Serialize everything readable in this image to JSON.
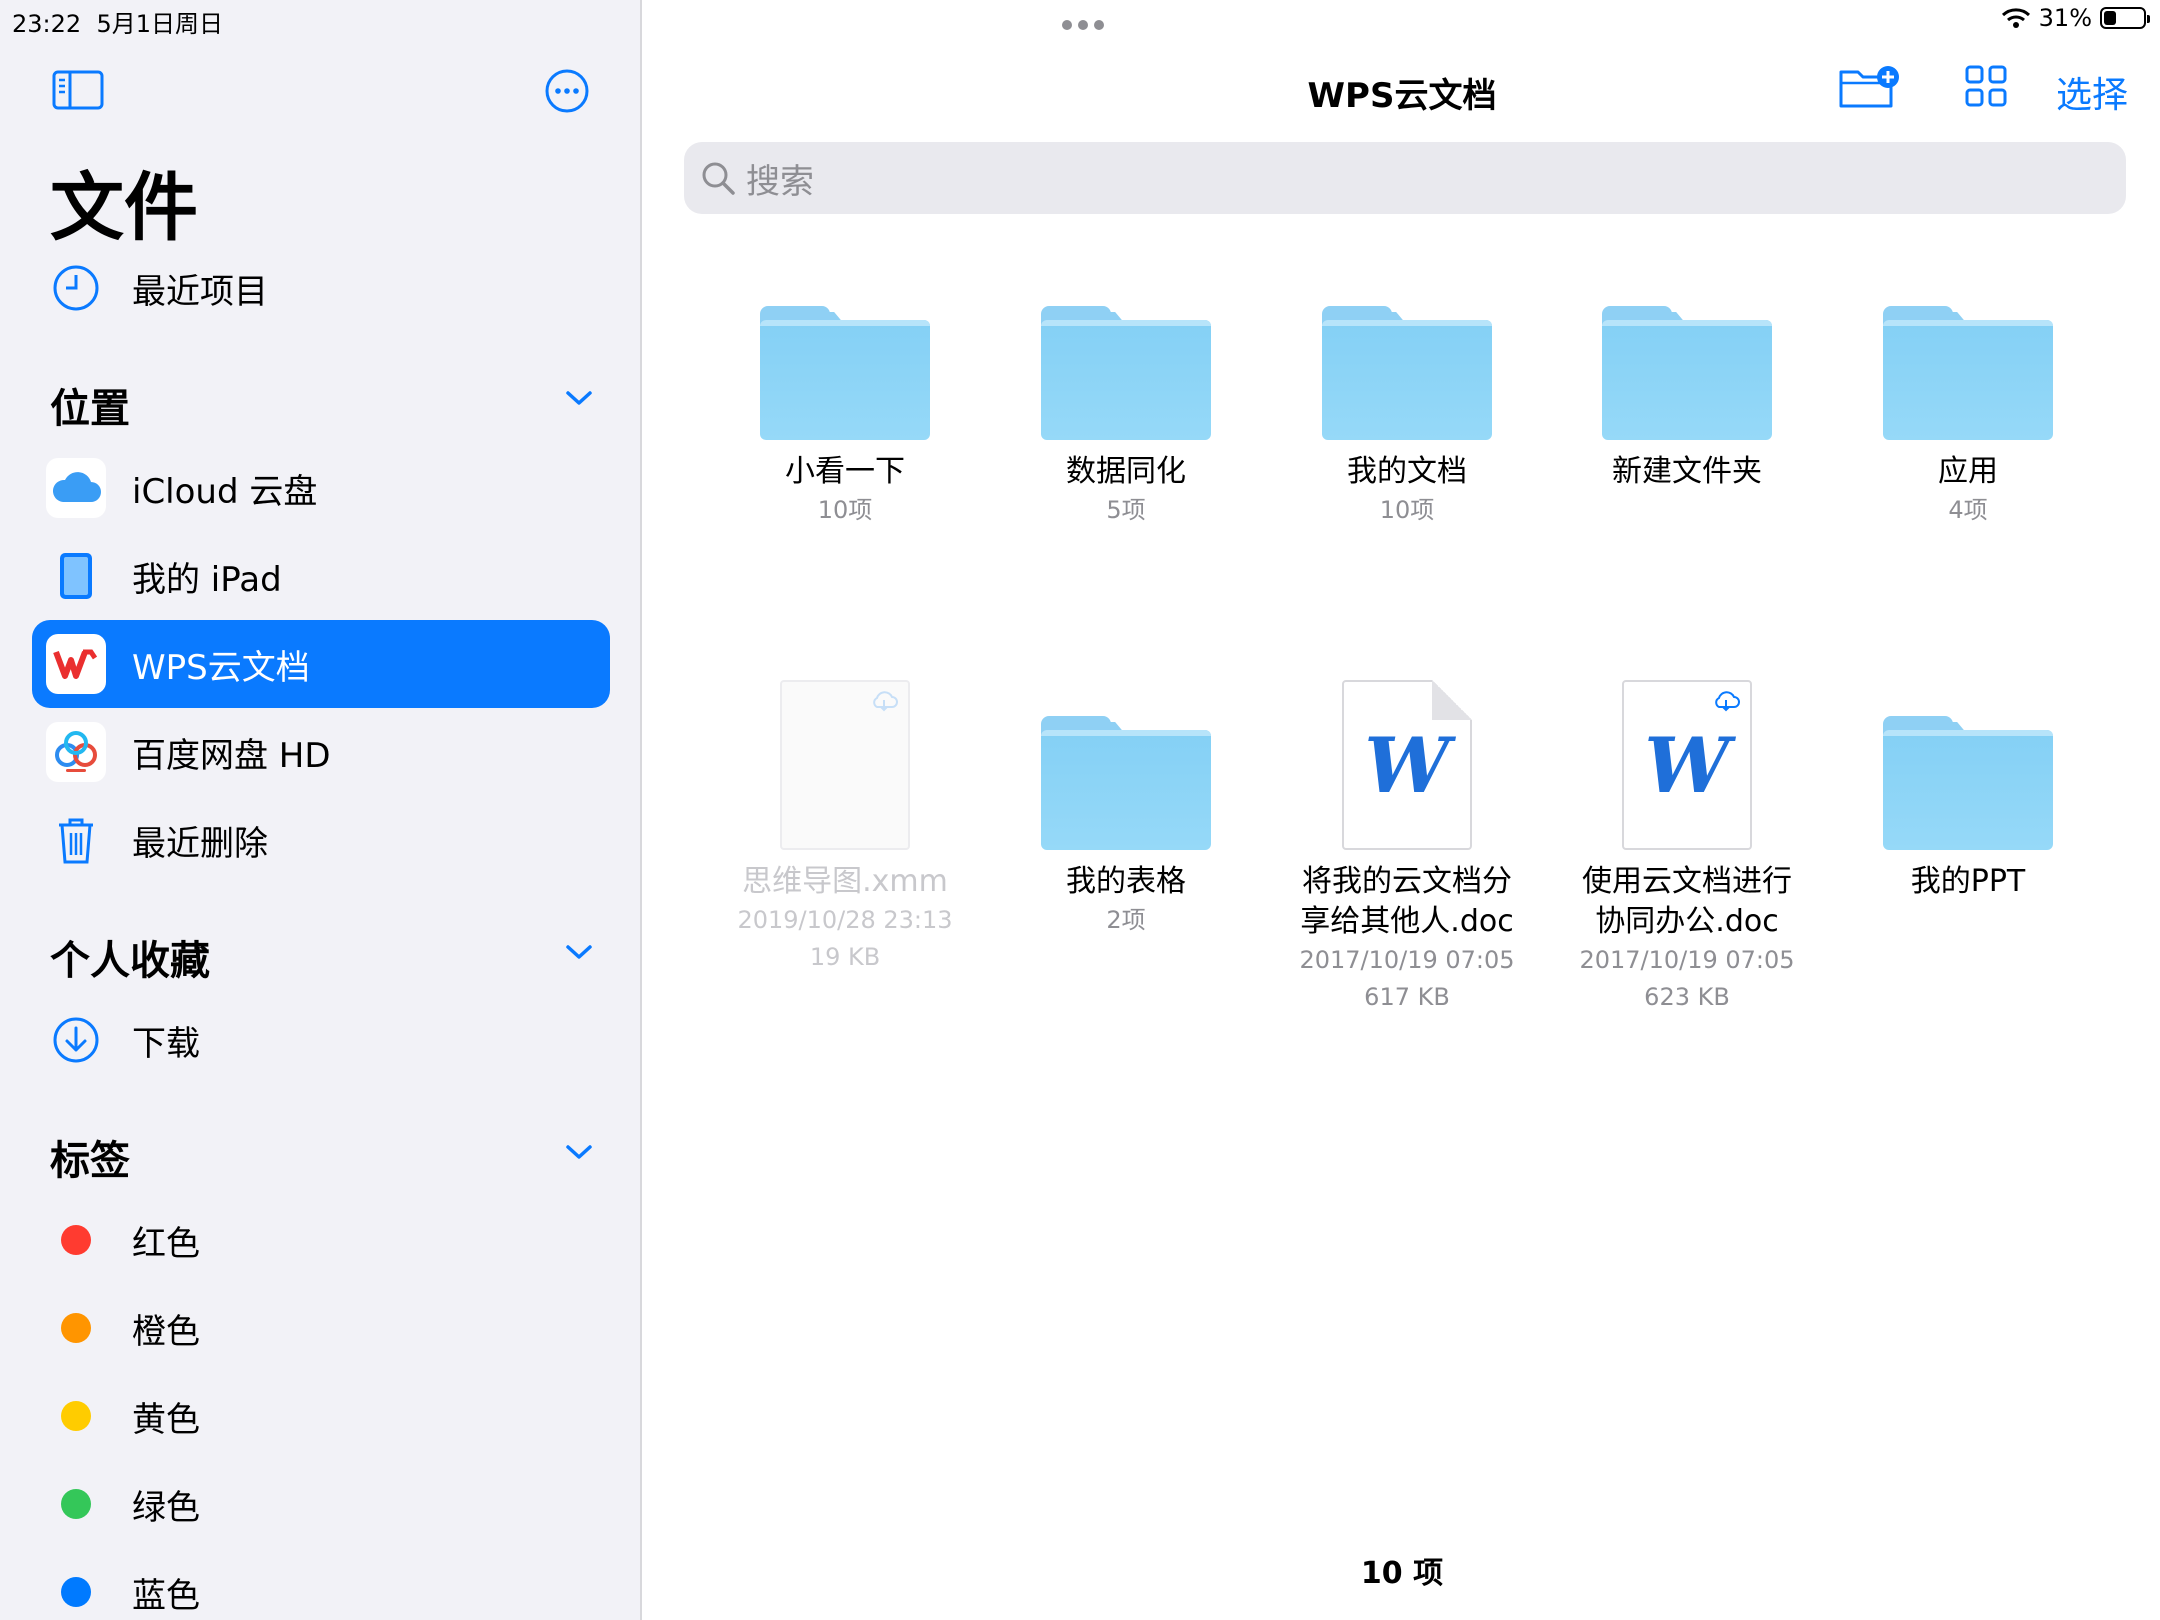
{
  "status": {
    "time": "23:22",
    "date": "5月1日周日",
    "battery": "31%",
    "battery_level": 0.31
  },
  "sidebar": {
    "title": "文件",
    "recents": "最近项目",
    "sections": {
      "locations": "位置",
      "favorites": "个人收藏",
      "tags": "标签"
    },
    "locations": [
      {
        "label": "iCloud 云盘",
        "icon": "icloud-icon"
      },
      {
        "label": "我的 iPad",
        "icon": "ipad-icon"
      },
      {
        "label": "WPS云文档",
        "icon": "wps-icon",
        "selected": true
      },
      {
        "label": "百度网盘 HD",
        "icon": "baidu-netdisk-icon"
      },
      {
        "label": "最近删除",
        "icon": "trash-icon"
      }
    ],
    "favorites": [
      {
        "label": "下载",
        "icon": "download-icon"
      }
    ],
    "tags": [
      {
        "label": "红色",
        "color": "#ff3b30"
      },
      {
        "label": "橙色",
        "color": "#ff9500"
      },
      {
        "label": "黄色",
        "color": "#ffcc00"
      },
      {
        "label": "绿色",
        "color": "#34c759"
      },
      {
        "label": "蓝色",
        "color": "#007aff"
      }
    ]
  },
  "main": {
    "title": "WPS云文档",
    "select_label": "选择",
    "search_placeholder": "搜索",
    "items": [
      {
        "type": "folder",
        "name": "小看一下",
        "meta1": "10项"
      },
      {
        "type": "folder",
        "name": "数据同化",
        "meta1": "5项"
      },
      {
        "type": "folder",
        "name": "我的文档",
        "meta1": "10项"
      },
      {
        "type": "folder",
        "name": "新建文件夹"
      },
      {
        "type": "folder",
        "name": "应用",
        "meta1": "4项"
      },
      {
        "type": "file-cloud",
        "name": "思维导图.xmm",
        "meta1": "2019/10/28 23:13",
        "meta2": "19 KB"
      },
      {
        "type": "folder",
        "name": "我的表格",
        "meta1": "2项"
      },
      {
        "type": "word",
        "name": "将我的云文档分享给其他人.doc",
        "meta1": "2017/10/19 07:05",
        "meta2": "617 KB"
      },
      {
        "type": "word-cloud",
        "name": "使用云文档进行协同办公.doc",
        "meta1": "2017/10/19 07:05",
        "meta2": "623 KB"
      },
      {
        "type": "folder",
        "name": "我的PPT"
      }
    ],
    "footer_count": "10 项"
  }
}
